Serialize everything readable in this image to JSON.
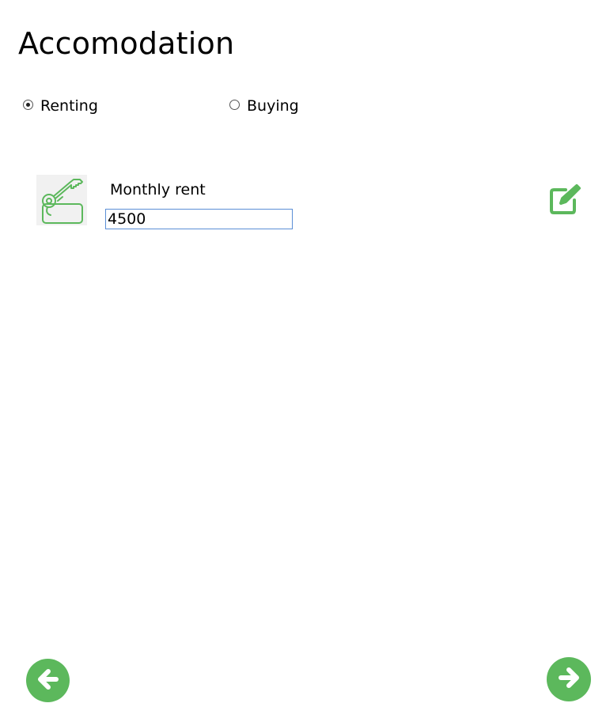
{
  "page": {
    "title": "Accomodation"
  },
  "housing_type": {
    "options": [
      {
        "label": "Renting",
        "checked": true
      },
      {
        "label": "Buying",
        "checked": false
      }
    ]
  },
  "rent_item": {
    "icon": "key-tag-icon",
    "label": "Monthly rent",
    "value": "4500",
    "edit_icon": "edit-icon"
  },
  "navigation": {
    "back_icon": "arrow-left-icon",
    "next_icon": "arrow-right-icon"
  },
  "colors": {
    "accent": "#5cb85c",
    "icon_background": "#f1f1f1",
    "input_border": "#5b8ed6"
  }
}
